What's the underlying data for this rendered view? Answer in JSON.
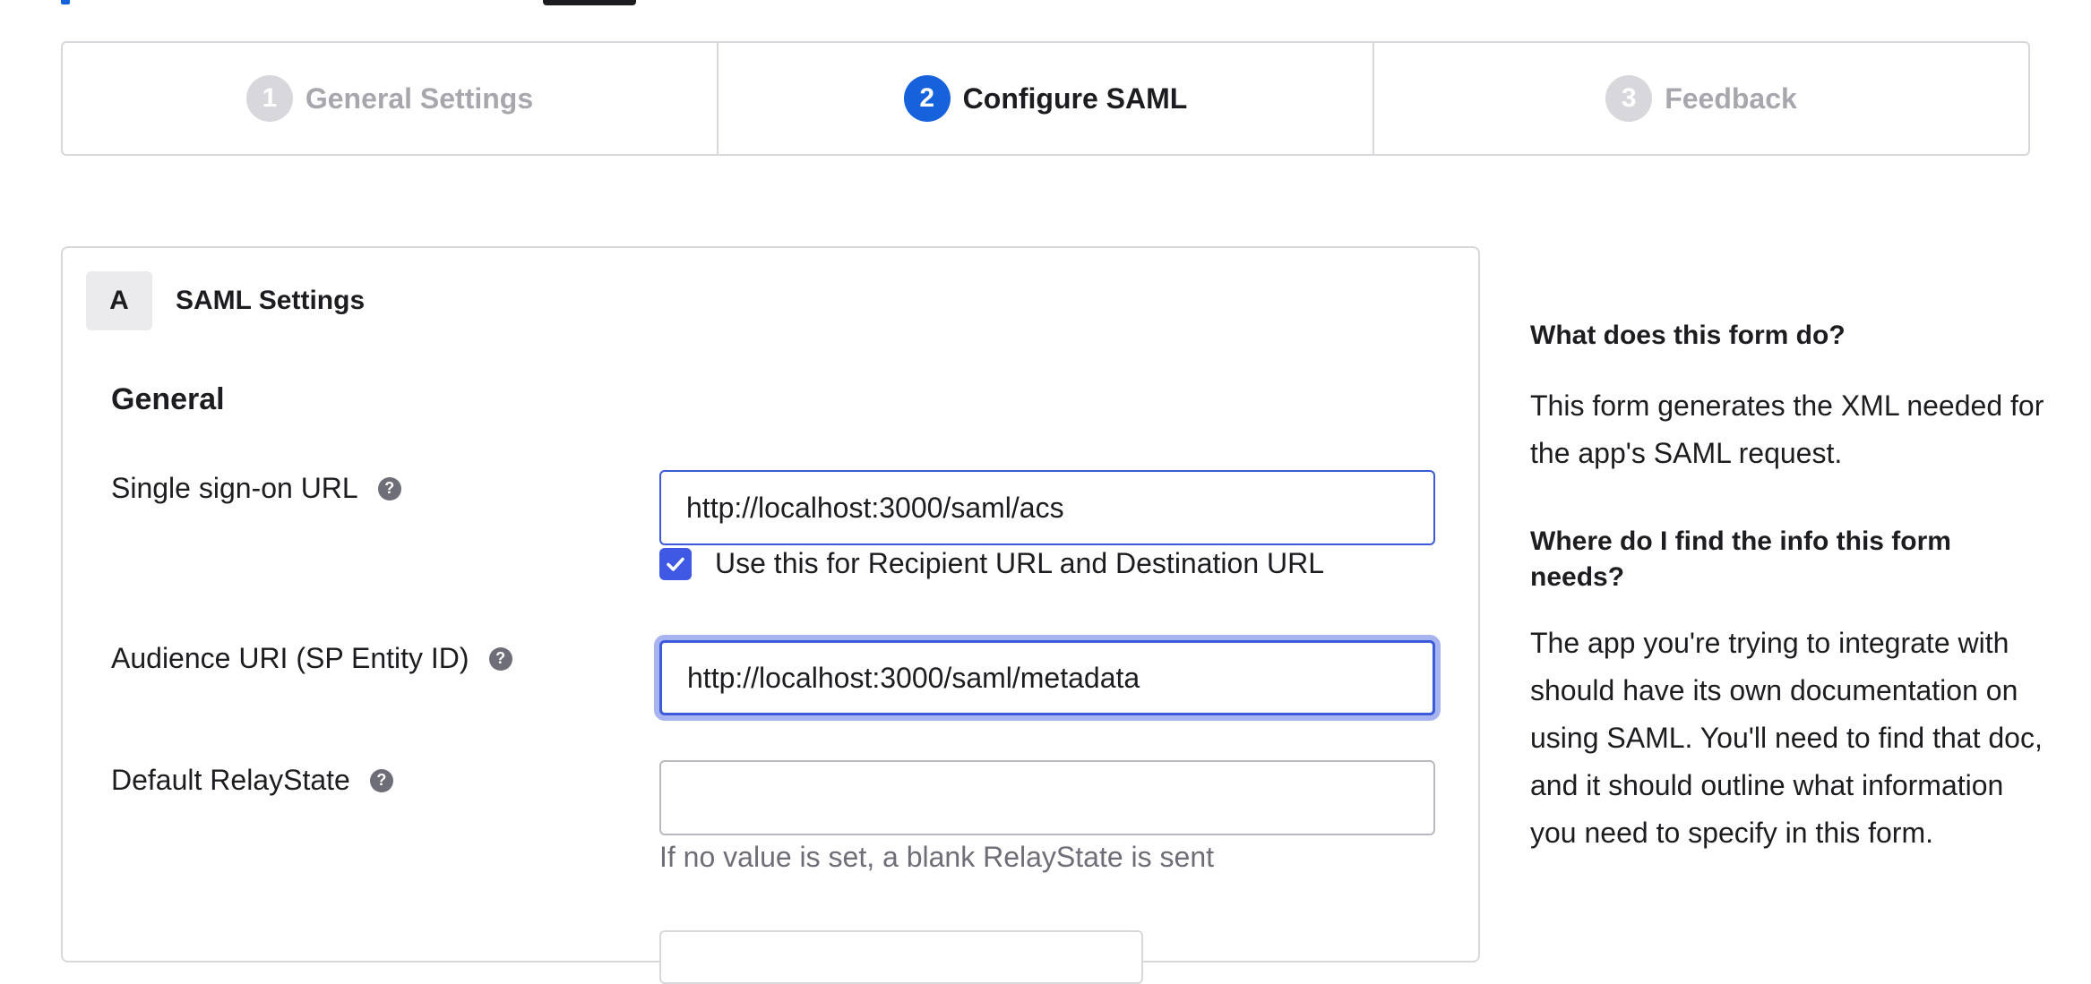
{
  "steps": [
    {
      "number": "1",
      "label": "General Settings",
      "state": "inactive"
    },
    {
      "number": "2",
      "label": "Configure SAML",
      "state": "active"
    },
    {
      "number": "3",
      "label": "Feedback",
      "state": "inactive"
    }
  ],
  "card": {
    "badge": "A",
    "title": "SAML Settings",
    "section_title": "General",
    "fields": {
      "sso_url": {
        "label": "Single sign-on URL",
        "value": "http://localhost:3000/saml/acs"
      },
      "recipient_checkbox": {
        "label": "Use this for Recipient URL and Destination URL",
        "checked": true
      },
      "audience_uri": {
        "label": "Audience URI (SP Entity ID)",
        "value": "http://localhost:3000/saml/metadata"
      },
      "relay_state": {
        "label": "Default RelayState",
        "value": "",
        "hint": "If no value is set, a blank RelayState is sent"
      }
    }
  },
  "help_panel": {
    "q1": "What does this form do?",
    "a1": "This form generates the XML needed for the app's SAML request.",
    "q2": "Where do I find the info this form needs?",
    "a2": "The app you're trying to integrate with should have its own documentation on using SAML. You'll need to find that doc, and it should outline what information you need to specify in this form."
  },
  "icons": {
    "help": "question-mark-icon",
    "check": "checkmark-icon"
  },
  "colors": {
    "accent": "#1662dd",
    "checkbox": "#3f59e4",
    "focus_ring": "#a7b4f0",
    "muted": "#a7a7ae"
  }
}
